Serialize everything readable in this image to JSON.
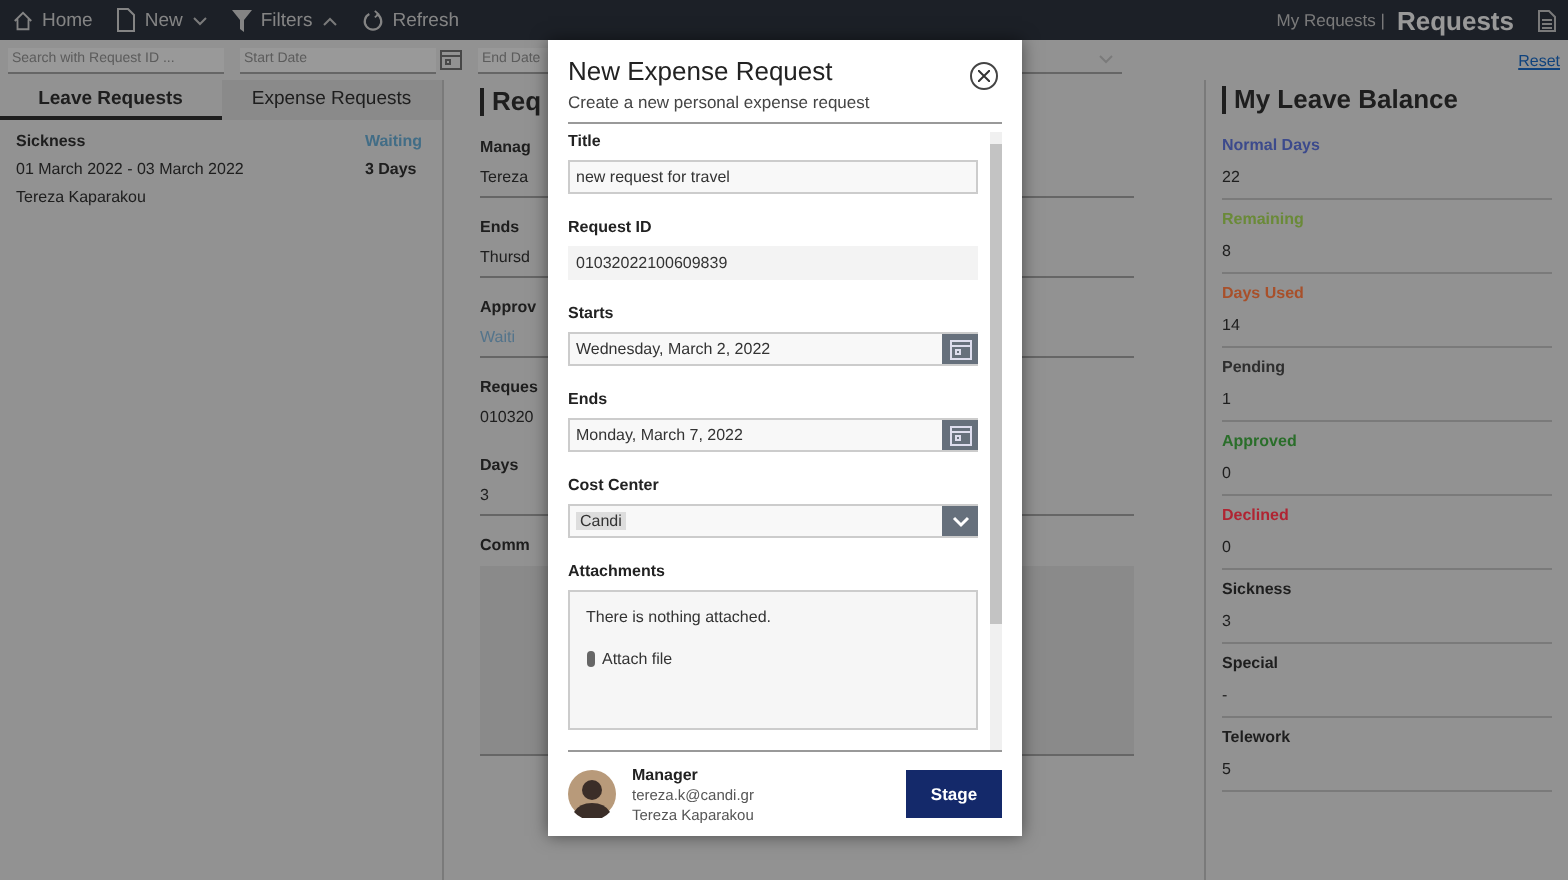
{
  "toolbar": {
    "items": [
      {
        "kind": "home",
        "label": "Home"
      },
      {
        "kind": "new",
        "label": "New",
        "expanded": false
      },
      {
        "kind": "filter",
        "label": "Filters",
        "expanded": true
      },
      {
        "kind": "refresh",
        "label": "Refresh"
      }
    ],
    "breadcrumb": "My Requests |",
    "title": "Requests"
  },
  "filters": {
    "search": {
      "placeholder": "Search with Request ID ..."
    },
    "start_date": {
      "placeholder": "Start Date"
    },
    "end_date": {
      "placeholder": "End Date"
    },
    "reset": "Reset"
  },
  "tabs": [
    {
      "label": "Leave Requests",
      "selected": true
    },
    {
      "label": "Expense Requests",
      "selected": false
    }
  ],
  "requests": [
    {
      "type": "Sickness",
      "status": "Waiting",
      "dates": "01  March 2022 - 03  March 2022",
      "duration": "3 Days",
      "person": "Tereza Kaparakou"
    }
  ],
  "details": {
    "title": "Req",
    "fields": [
      {
        "label": "Manag",
        "value": "Tereza"
      },
      {
        "label": "Ends",
        "value": "Thursd"
      },
      {
        "label": "Approv",
        "value": "Waiti",
        "kind": "status"
      },
      {
        "label": "Reques",
        "value": "010320",
        "kind": "plain"
      },
      {
        "label": "Days",
        "value": "3"
      },
      {
        "label": "Comm",
        "kind": "comment"
      }
    ]
  },
  "balance": {
    "title": "My Leave Balance",
    "items": [
      {
        "label": "Normal Days",
        "value": "22",
        "color": "#3c4a8c"
      },
      {
        "label": "Remaining",
        "value": "8",
        "color": "#6a8a38"
      },
      {
        "label": "Days Used",
        "value": "14",
        "color": "#a8502a"
      },
      {
        "label": "Pending",
        "value": "1",
        "color": "#2e2e2e"
      },
      {
        "label": "Approved",
        "value": "0",
        "color": "#2a6e2a"
      },
      {
        "label": "Declined",
        "value": "0",
        "color": "#b02432"
      },
      {
        "label": "Sickness",
        "value": "3",
        "color": "#1e1e1e"
      },
      {
        "label": "Special",
        "value": "-",
        "color": "#1e1e1e"
      },
      {
        "label": "Telework",
        "value": "5",
        "color": "#1e1e1e"
      }
    ]
  },
  "dialog": {
    "title": "New Expense Request",
    "subtitle": "Create a new personal expense request",
    "fields": [
      {
        "kind": "text",
        "label": "Title",
        "value": "new request for travel"
      },
      {
        "kind": "readonly",
        "label": "Request ID",
        "value": "01032022100609839"
      },
      {
        "kind": "date",
        "label": "Starts",
        "value": "Wednesday, March 2, 2022"
      },
      {
        "kind": "date",
        "label": "Ends",
        "value": "Monday, March 7, 2022"
      },
      {
        "kind": "select",
        "label": "Cost Center",
        "value": "Candi"
      },
      {
        "kind": "attachments",
        "label": "Attachments",
        "value": "There is nothing attached.",
        "action": "Attach file"
      }
    ],
    "manager": {
      "role": "Manager",
      "email": "tereza.k@candi.gr",
      "name": "Tereza Kaparakou"
    },
    "button": "Stage"
  }
}
